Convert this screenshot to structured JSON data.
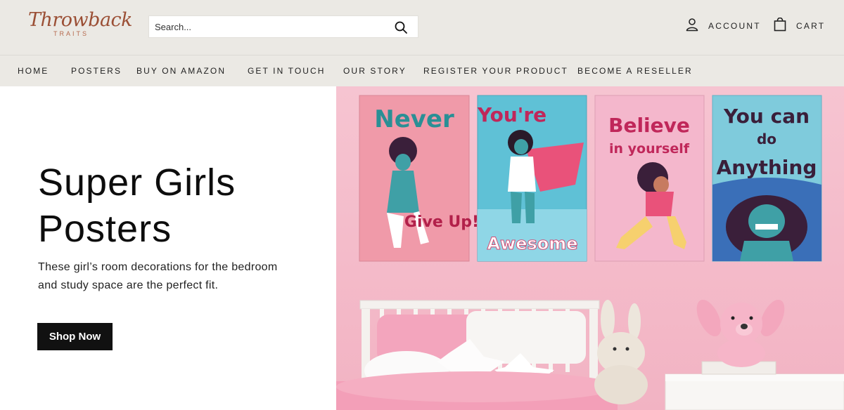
{
  "header": {
    "logo_word": "Throwback",
    "logo_sub": "TRAITS",
    "search_placeholder": "Search...",
    "account_label": "ACCOUNT",
    "cart_label": "CART"
  },
  "nav": {
    "items": [
      {
        "label": "HOME"
      },
      {
        "label": "POSTERS"
      },
      {
        "label": "BUY ON AMAZON"
      },
      {
        "label": "GET IN TOUCH"
      },
      {
        "label": "OUR STORY"
      },
      {
        "label": "REGISTER YOUR PRODUCT"
      },
      {
        "label": "BECOME A RESELLER"
      }
    ]
  },
  "hero": {
    "title_line1": "Super Girls",
    "title_line2": "Posters",
    "description": "These girl’s room decorations for the bedroom and study space are the perfect fit.",
    "button_label": "Shop Now",
    "posters": [
      {
        "top": "Never",
        "bottom": "Give Up!"
      },
      {
        "top": "You're",
        "bottom": "Awesome"
      },
      {
        "top": "Believe",
        "bottom": "in yourself"
      },
      {
        "top": "You can",
        "middle": "do",
        "bottom": "Anything"
      }
    ]
  },
  "colors": {
    "header_bg": "#ebe9e4",
    "logo": "#9b4f35",
    "wall_pink": "#f4bccb",
    "button_bg": "#111111"
  }
}
